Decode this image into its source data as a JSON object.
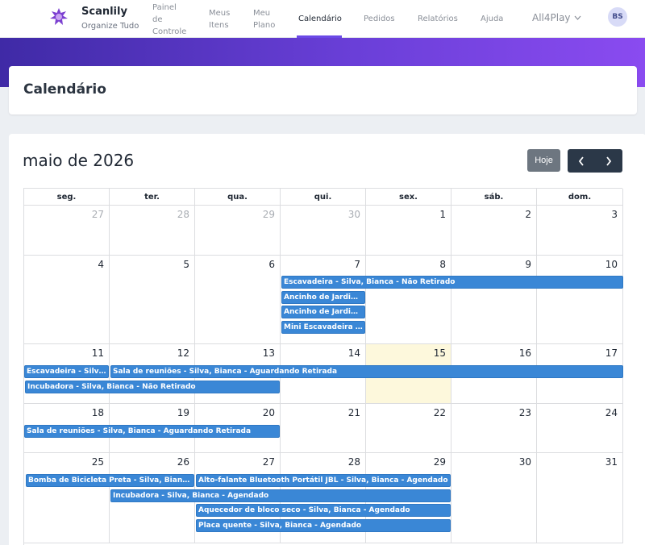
{
  "brand": {
    "name": "Scanlily",
    "tagline": "Organize Tudo"
  },
  "nav": {
    "painel": [
      "Painel",
      "de",
      "Controle"
    ],
    "itens": [
      "Meus",
      "Itens"
    ],
    "plano": [
      "Meu",
      "Plano"
    ],
    "calendario": "Calendário",
    "pedidos": "Pedidos",
    "relatorios": "Relatórios",
    "ajuda": "Ajuda",
    "org": "All4Play",
    "avatar": "BS"
  },
  "page": {
    "title": "Calendário"
  },
  "calendar": {
    "month_label": "maio de 2026",
    "today_label": "Hoje",
    "weekdays": [
      "seg.",
      "ter.",
      "qua.",
      "qui.",
      "sex.",
      "sáb.",
      "dom."
    ],
    "weeks": [
      [
        "27",
        "28",
        "29",
        "30",
        "1",
        "2",
        "3"
      ],
      [
        "4",
        "5",
        "6",
        "7",
        "8",
        "9",
        "10"
      ],
      [
        "11",
        "12",
        "13",
        "14",
        "15",
        "16",
        "17"
      ],
      [
        "18",
        "19",
        "20",
        "21",
        "22",
        "23",
        "24"
      ],
      [
        "25",
        "26",
        "27",
        "28",
        "29",
        "30",
        "31"
      ]
    ],
    "events": [
      "Escavadeira - Silva, Bianca - Não Retirado",
      "Ancinho de Jardim ...",
      "Ancinho de Jardim ...",
      "Mini Escavadeira - ...",
      "Escavadeira - Silva, ...",
      "Sala de reuniões - Silva, Bianca - Aguardando Retirada",
      "Incubadora - Silva, Bianca - Não Retirado",
      "Sala de reuniões - Silva, Bianca - Aguardando Retirada",
      "Bomba de Bicicleta Preta - Silva, Bianca - ...",
      "Alto-falante Bluetooth Portátil JBL - Silva, Bianca - Agendado",
      "Incubadora - Silva, Bianca - Agendado",
      "Aquecedor de bloco seco - Silva, Bianca - Agendado",
      "Placa quente - Silva, Bianca - Agendado"
    ]
  },
  "colors": {
    "accent": "#6b49e6",
    "event": "#3a87d6",
    "today": "#fdf8dc",
    "nav_dark": "#2b3848"
  }
}
